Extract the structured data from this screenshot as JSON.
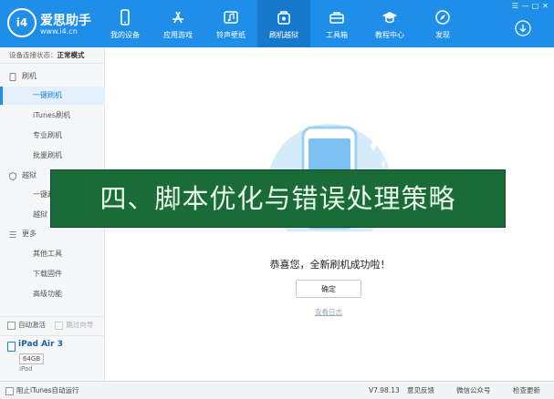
{
  "header": {
    "brand_name": "爱思助手",
    "brand_url": "www.i4.cn",
    "logo_text": "i4",
    "nav": [
      {
        "label": "我的设备",
        "icon": "phone-icon"
      },
      {
        "label": "应用游戏",
        "icon": "app-store-icon"
      },
      {
        "label": "铃声壁纸",
        "icon": "music-icon"
      },
      {
        "label": "刷机越狱",
        "icon": "jailbreak-icon",
        "active": true
      },
      {
        "label": "工具箱",
        "icon": "toolbox-icon"
      },
      {
        "label": "教程中心",
        "icon": "graduation-cap-icon"
      },
      {
        "label": "发现",
        "icon": "compass-icon"
      }
    ],
    "window_controls": [
      "☰",
      "—",
      "□",
      "✕"
    ]
  },
  "sidebar": {
    "status_label": "设备连接状态：",
    "status_value": "正常模式",
    "sections": [
      {
        "label": "刷机",
        "icon": "phone-icon",
        "items": [
          "一键刷机",
          "iTunes刷机",
          "专业刷机",
          "批量刷机"
        ]
      },
      {
        "label": "越狱",
        "icon": "shield-icon",
        "items": [
          "一键越",
          "越狱"
        ]
      },
      {
        "label": "更多",
        "icon": "list-icon",
        "items": [
          "其他工具",
          "下载固件",
          "高级功能"
        ]
      }
    ],
    "active_item": "一键刷机",
    "auto_activate": "自动激活",
    "skip_guide": "跳过向导",
    "device": {
      "name": "iPad Air 3",
      "capacity": "64GB",
      "type": "iPad"
    }
  },
  "main": {
    "success_message": "恭喜您，全新刷机成功啦！",
    "confirm_label": "确定",
    "log_link": "查看日志"
  },
  "footer": {
    "block_itunes": "阻止iTunes自动运行",
    "version": "V7.98.13",
    "feedback": "意见反馈",
    "wechat": "微信公众号",
    "update": "检查更新"
  },
  "overlay": {
    "banner_text": "四、脚本优化与错误处理策略"
  },
  "colors": {
    "header": "#1e8ee8",
    "active_nav": "#1779cc",
    "banner": "#1b6b38"
  }
}
